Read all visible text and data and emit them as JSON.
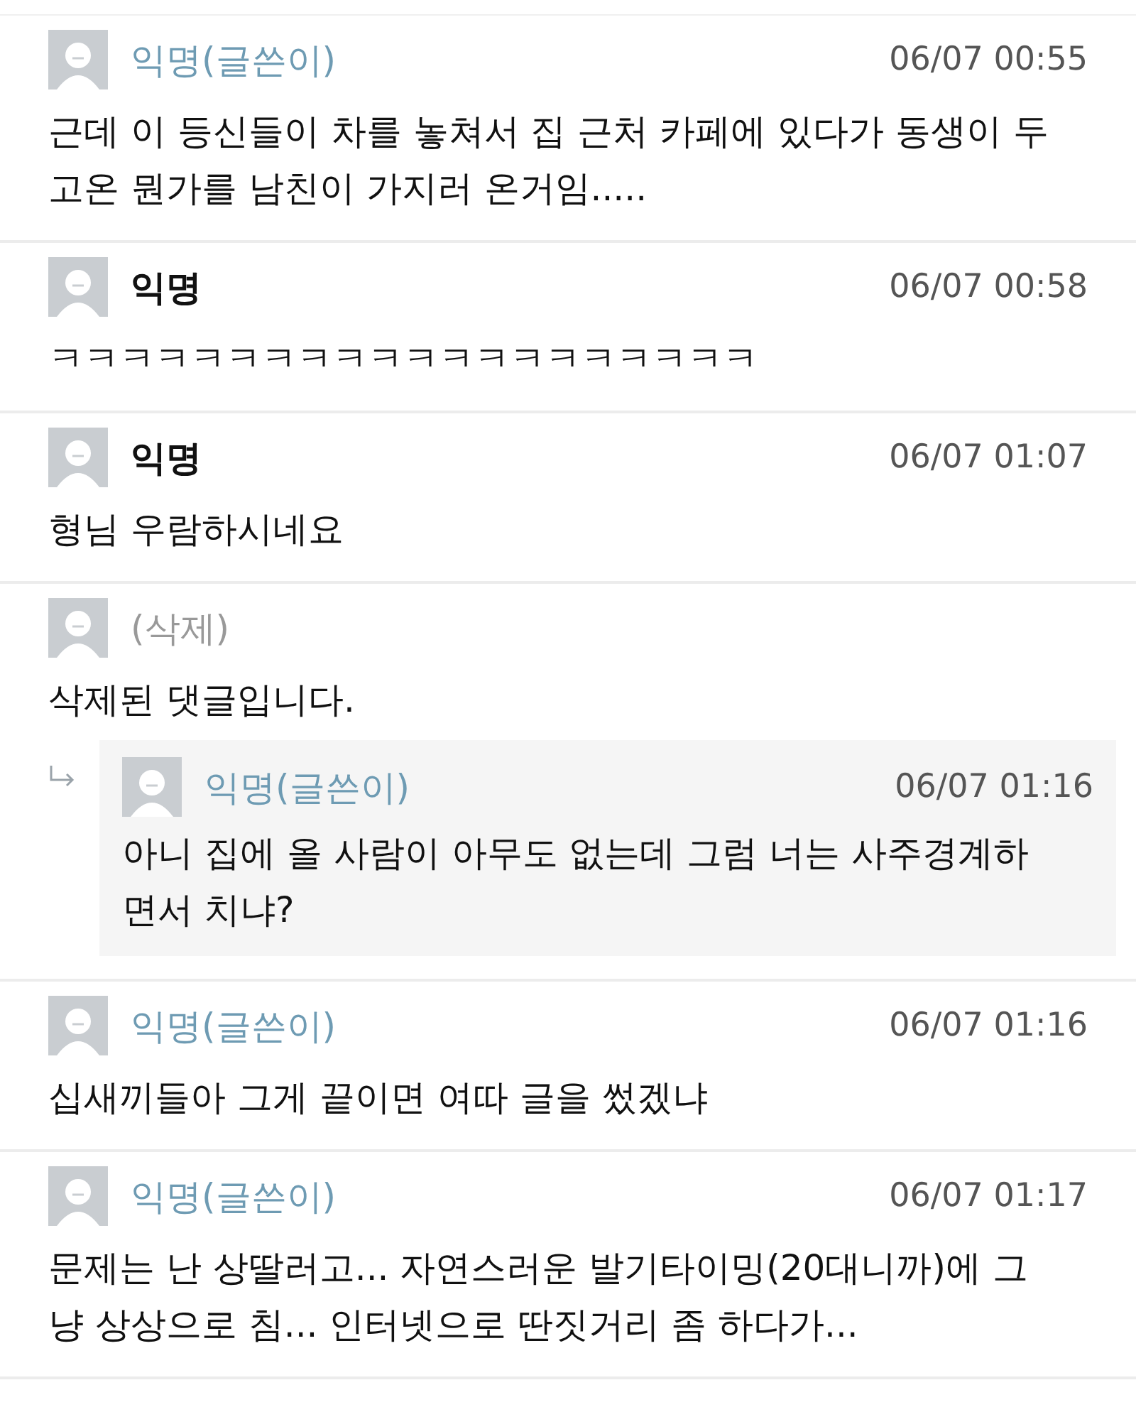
{
  "comments": [
    {
      "author": "익명(글쓴이)",
      "kind": "writer",
      "time": "06/07 00:55",
      "lines": [
        "근데 이 등신들이 차를 놓쳐서 집 근처 카페에 있다가 동생이 두",
        "고온 뭔가를 남친이 가지러 온거임....."
      ]
    },
    {
      "author": "익명",
      "kind": "normal",
      "time": "06/07 00:58",
      "lines": [
        "ㅋㅋㅋㅋㅋㅋㅋㅋㅋㅋㅋㅋㅋㅋㅋㅋㅋㅋㅋㅋ"
      ]
    },
    {
      "author": "익명",
      "kind": "normal",
      "time": "06/07 01:07",
      "lines": [
        "형님 우람하시네요"
      ]
    },
    {
      "author": "(삭제)",
      "kind": "deleted",
      "lines": [
        "삭제된 댓글입니다."
      ],
      "children": [
        {
          "author": "익명(글쓴이)",
          "kind": "writer",
          "time": "06/07 01:16",
          "lines": [
            "아니 집에 올 사람이 아무도 없는데 그럼 너는 사주경계하",
            "면서 치냐?"
          ]
        }
      ]
    },
    {
      "author": "익명(글쓴이)",
      "kind": "writer",
      "time": "06/07 01:16",
      "lines": [
        "십새끼들아 그게 끝이면 여따 글을 썼겠냐"
      ]
    },
    {
      "author": "익명(글쓴이)",
      "kind": "writer",
      "time": "06/07 01:17",
      "lines": [
        "문제는 난 상딸러고... 자연스러운 발기타이밍(20대니까)에 그",
        "냥 상상으로 침... 인터넷으로 딴짓거리 좀 하다가..."
      ]
    }
  ]
}
